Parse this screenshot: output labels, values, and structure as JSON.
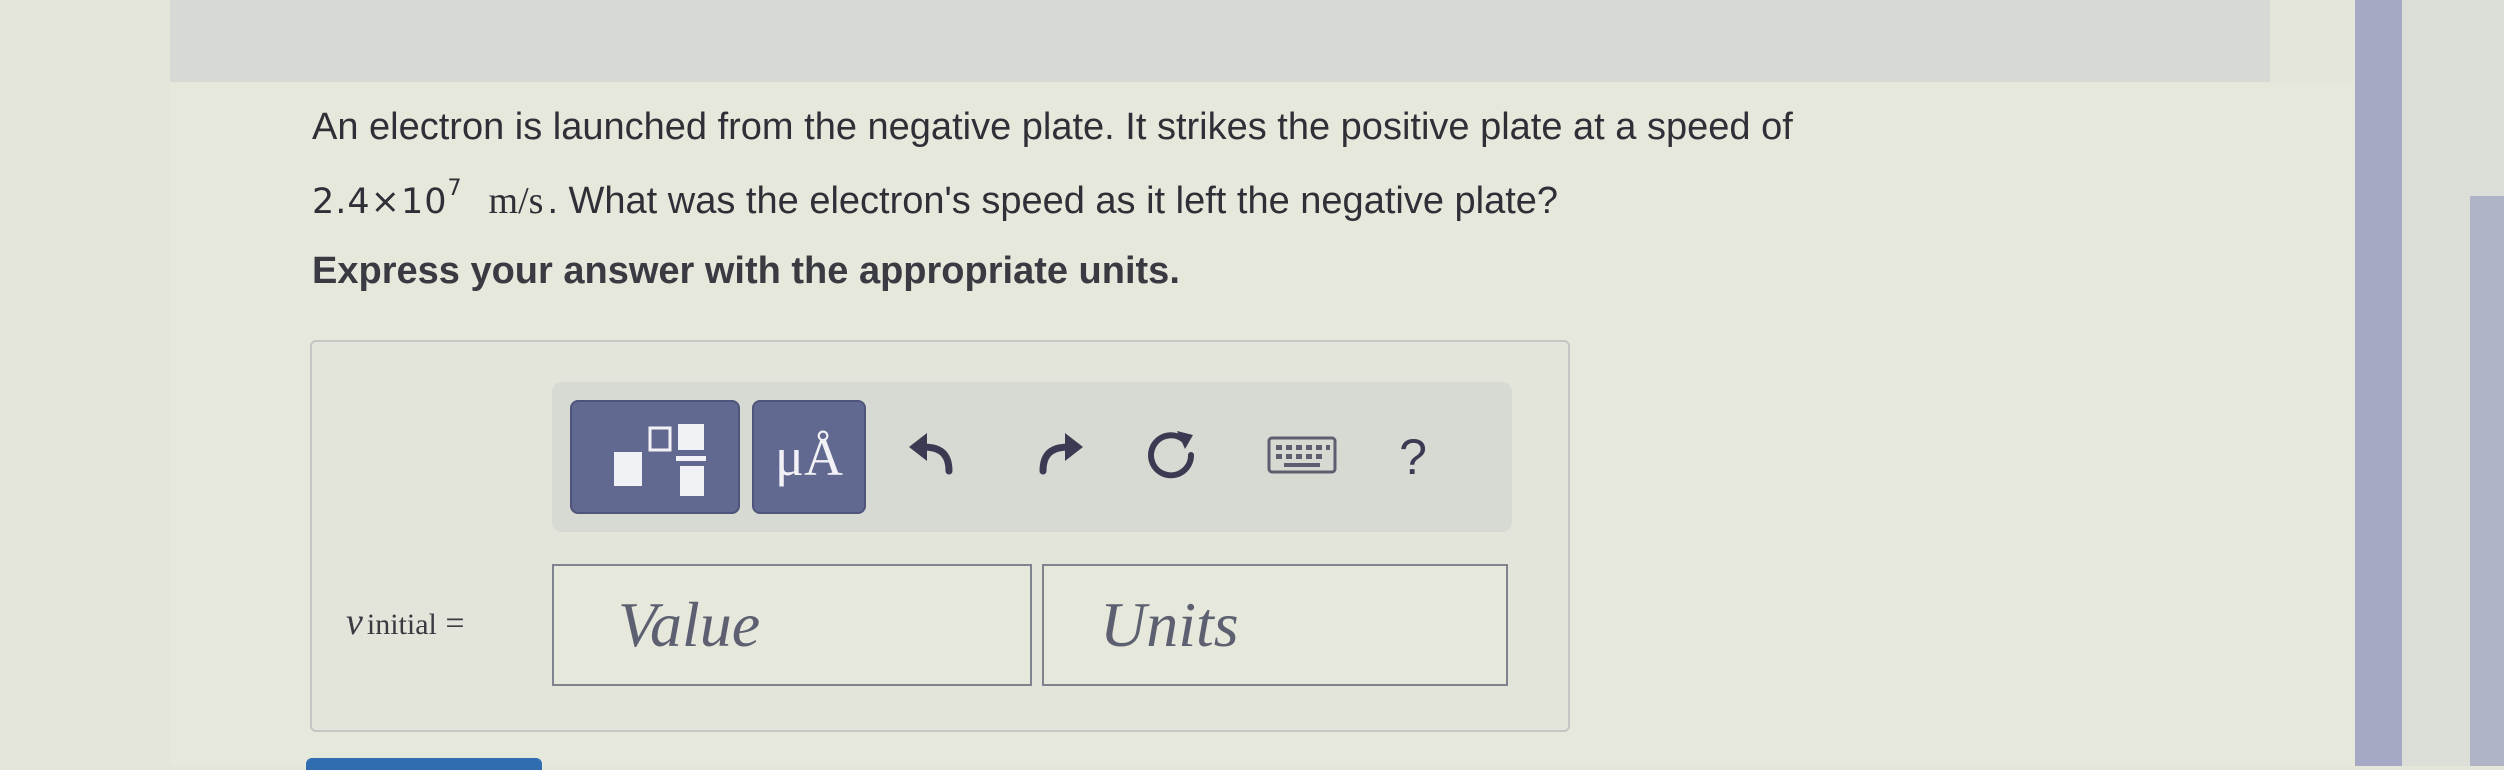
{
  "question": {
    "line1": "An electron is launched from the negative plate. It strikes the positive plate at a speed of",
    "speed_mantissa": "2.4×10",
    "speed_exponent": "7",
    "speed_unit": "m/s",
    "line2_rest": ". What was the electron's speed as it left the negative plate?"
  },
  "instruction": "Express your answer with the appropriate units.",
  "toolbar": {
    "units_label": "μÅ",
    "help_label": "?",
    "icons": [
      "templates-icon",
      "undo-icon",
      "redo-icon",
      "reset-icon",
      "keyboard-icon"
    ]
  },
  "answer": {
    "variable": "v",
    "subscript": "initial",
    "equals": "=",
    "value_placeholder": "Value",
    "units_placeholder": "Units"
  },
  "colors": {
    "toolbar_button": "#626991",
    "icon": "#3a3b52",
    "submit": "#2f6db0"
  }
}
